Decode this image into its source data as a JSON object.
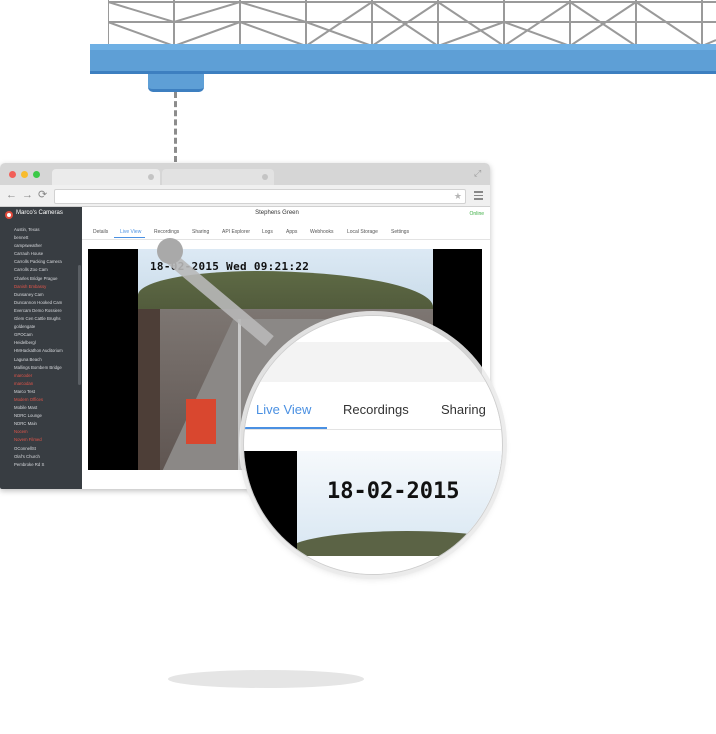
{
  "app": {
    "account_name": "Marco's Cameras",
    "camera_title": "Stephens Green",
    "status": "Online"
  },
  "colors": {
    "accent": "#4a90e2",
    "online": "#3cae43",
    "sidebar_bg": "#383d42",
    "beam": "#5e9fd6",
    "highlight_item": "#e5554a"
  },
  "sidebar": {
    "items": [
      {
        "label": "Austin, Texas",
        "highlight": false
      },
      {
        "label": "bennett",
        "highlight": false
      },
      {
        "label": "campsweather",
        "highlight": false
      },
      {
        "label": "Carrauh House",
        "highlight": false
      },
      {
        "label": "Carrolls Packing Camera",
        "highlight": false
      },
      {
        "label": "Carrolls Zoo Cam",
        "highlight": false
      },
      {
        "label": "Charles Bridge Prague",
        "highlight": false
      },
      {
        "label": "Danish Embassy",
        "highlight": true
      },
      {
        "label": "Dunsaney Cam",
        "highlight": false
      },
      {
        "label": "Duncannon Hooked Cam",
        "highlight": false
      },
      {
        "label": "Evercam Demo Rossiere",
        "highlight": false
      },
      {
        "label": "Glem Cen Cattle Brughs",
        "highlight": false
      },
      {
        "label": "goldengate",
        "highlight": false
      },
      {
        "label": "GPOCam",
        "highlight": false
      },
      {
        "label": "Heidelbergl",
        "highlight": false
      },
      {
        "label": "HMHackathon Auditorium",
        "highlight": false
      },
      {
        "label": "Laguna Beach",
        "highlight": false
      },
      {
        "label": "Mallings Bombem Bridge",
        "highlight": false
      },
      {
        "label": "marcoder",
        "highlight": true
      },
      {
        "label": "marcodan",
        "highlight": true
      },
      {
        "label": "Marco Test",
        "highlight": false
      },
      {
        "label": "Modern Offices",
        "highlight": true
      },
      {
        "label": "Mobile Mast",
        "highlight": false
      },
      {
        "label": "NDRC Lounge",
        "highlight": false
      },
      {
        "label": "NDRC Main",
        "highlight": false
      },
      {
        "label": "Nocem",
        "highlight": true
      },
      {
        "label": "Novem Filmed",
        "highlight": true
      },
      {
        "label": "OConnellSt",
        "highlight": false
      },
      {
        "label": "Olaf's Church",
        "highlight": false
      },
      {
        "label": "Pembroke Rd S",
        "highlight": false
      }
    ]
  },
  "tabs": [
    {
      "label": "Details",
      "active": false
    },
    {
      "label": "Live View",
      "active": true
    },
    {
      "label": "Recordings",
      "active": false
    },
    {
      "label": "Sharing",
      "active": false
    },
    {
      "label": "API Explorer",
      "active": false
    },
    {
      "label": "Logs",
      "active": false
    },
    {
      "label": "Apps",
      "active": false
    },
    {
      "label": "Webhooks",
      "active": false
    },
    {
      "label": "Local Storage",
      "active": false
    },
    {
      "label": "Settings",
      "active": false
    }
  ],
  "video": {
    "timestamp": "18-02-2015 Wed 09:21:22"
  },
  "magnifier": {
    "tabs": [
      "Live View",
      "Recordings",
      "Sharing"
    ],
    "timestamp": "18-02-2015"
  },
  "icons": {
    "back": "arrow-left",
    "forward": "arrow-right",
    "reload": "reload",
    "bookmark": "star",
    "menu": "hamburger",
    "expand": "expand-arrows"
  }
}
